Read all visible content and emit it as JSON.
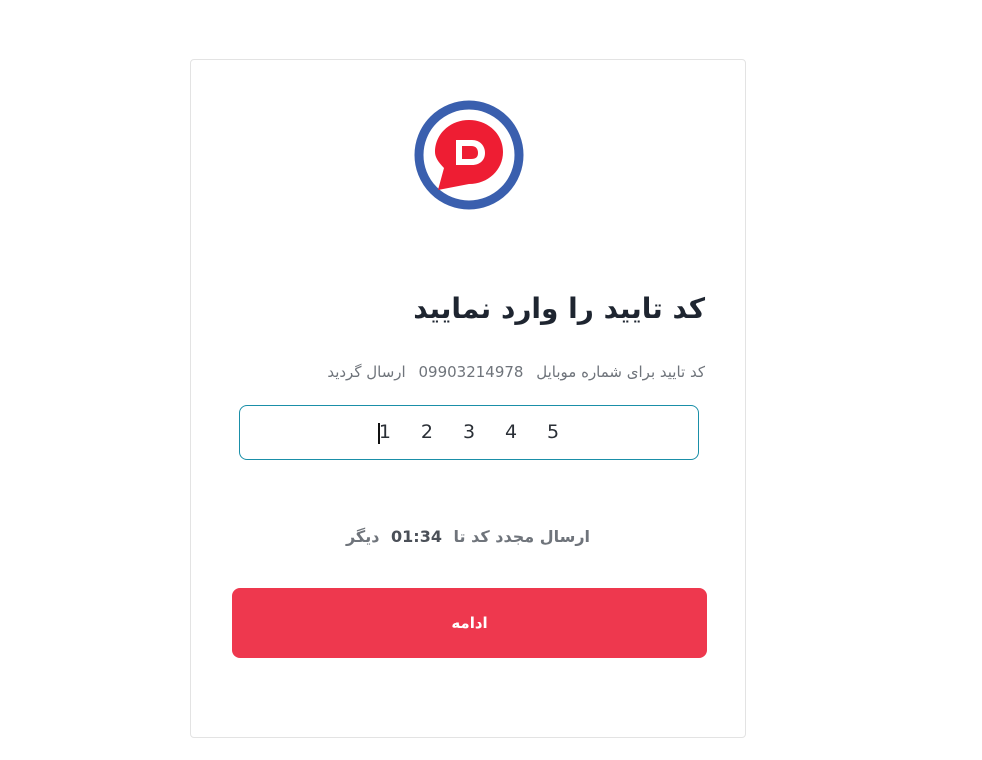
{
  "logo": {
    "name": "digikala-logo",
    "outer_ring_color": "#3a5fae",
    "pin_color": "#ee1d33"
  },
  "verify": {
    "title": "کد تایید را وارد نمایید",
    "subtitle_prefix": "کد تایید برای شماره موبایل",
    "phone": "09903214978",
    "subtitle_suffix": "ارسال گردید"
  },
  "otp": {
    "digits": [
      "1",
      "2",
      "3",
      "4",
      "5"
    ],
    "border_color": "#1a8fa8"
  },
  "resend": {
    "prefix": "ارسال مجدد کد تا",
    "timer": "01:34",
    "suffix": "دیگر"
  },
  "actions": {
    "continue_label": "ادامه",
    "continue_color": "#ee384e"
  }
}
